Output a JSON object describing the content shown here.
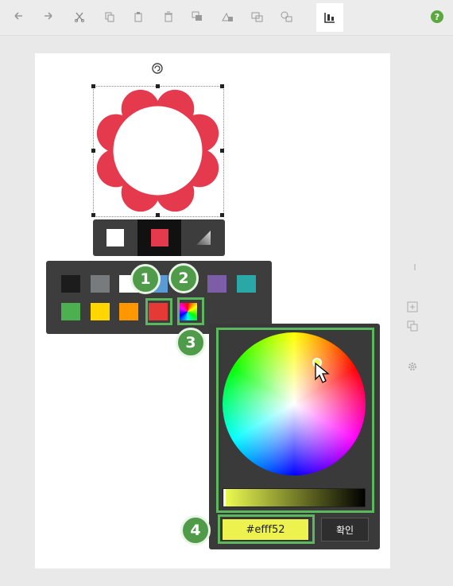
{
  "toolbar": {
    "buttons": [
      "undo-icon",
      "redo-icon",
      "cut-icon",
      "copy-icon",
      "paste-icon",
      "delete-icon",
      "bring-forward-icon",
      "send-backward-icon",
      "bring-to-front-icon",
      "send-to-back-icon",
      "align-icon"
    ],
    "help_label": "?"
  },
  "shape": {
    "fill_color": "#e5394d",
    "hole_color": "#ffffff"
  },
  "fill_tabs": [
    "#ffffff",
    "#e5394d",
    "gradient"
  ],
  "palette": {
    "row1": [
      "#1c1c1c",
      "#777b7e",
      "#ffffff",
      "#5b9bd5",
      "#7b5ea7",
      "#2aa8a8"
    ],
    "row2": [
      "#4caf50",
      "#ffd600",
      "#ff9800",
      "#e53935",
      "rainbow"
    ]
  },
  "picker": {
    "hex_value": "#efff52",
    "confirm_label": "확인"
  },
  "badges": [
    "1",
    "2",
    "3",
    "4"
  ],
  "colors": {
    "highlight": "#5cb85c",
    "badge": "#4f9b4a"
  }
}
